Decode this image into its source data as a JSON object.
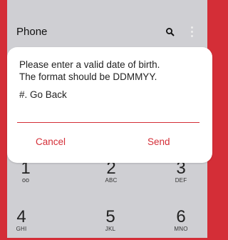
{
  "app_bar": {
    "title": "Phone",
    "icons": [
      "search-icon",
      "more-vert-icon"
    ]
  },
  "dialog": {
    "message_line1": "Please enter a valid date of birth.",
    "message_line2": "The format should be DDMMYY.",
    "option": "#. Go Back",
    "input_value": "",
    "cancel_label": "Cancel",
    "send_label": "Send",
    "accent_color": "#d42e37"
  },
  "dialpad": {
    "keys": [
      {
        "digit": "1",
        "letters": "oo"
      },
      {
        "digit": "2",
        "letters": "ABC"
      },
      {
        "digit": "3",
        "letters": "DEF"
      },
      {
        "digit": "4",
        "letters": "GHI"
      },
      {
        "digit": "5",
        "letters": "JKL"
      },
      {
        "digit": "6",
        "letters": "MNO"
      }
    ]
  },
  "colors": {
    "frame": "#d42e37",
    "screen": "#cfcfd3",
    "dialog_bg": "#ffffff"
  }
}
